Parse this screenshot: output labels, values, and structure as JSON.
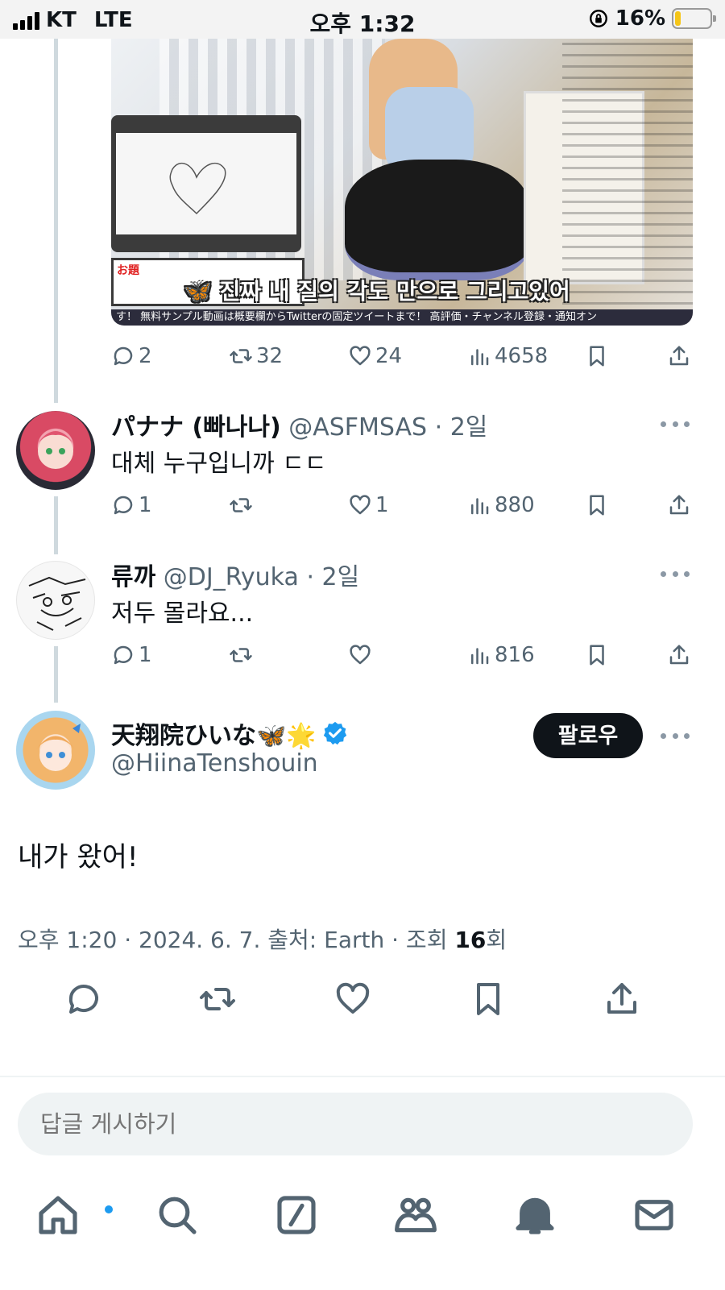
{
  "status_bar": {
    "carrier": "KT",
    "network": "LTE",
    "time": "오후 1:32",
    "battery_percent": "16%",
    "battery_level": 0.16
  },
  "media": {
    "board_label": "お題",
    "caption": "🦋 진짜 내 질의 각도 만으로 그리고있어",
    "ticker": "す！ 無料サンプル動画は概要欄からTwitterの固定ツイートまで！ 高評価・チャンネル登録・通知オン"
  },
  "quoted_post_actions": {
    "replies": "2",
    "reposts": "32",
    "likes": "24",
    "views": "4658"
  },
  "replies": [
    {
      "name": "パナナ (빠나나)",
      "handle": "@ASFMSAS",
      "time": "· 2일",
      "text": "대체 누구입니까 ㄷㄷ",
      "replies": "1",
      "reposts": "",
      "likes": "1",
      "views": "880"
    },
    {
      "name": "류까",
      "handle": "@DJ_Ryuka",
      "time": "· 2일",
      "text": "저두 몰라요...",
      "replies": "1",
      "reposts": "",
      "likes": "",
      "views": "816"
    }
  ],
  "main_post": {
    "name": "天翔院ひいな🦋🌟",
    "handle": "@HiinaTenshouin",
    "follow_label": "팔로우",
    "text": "내가 왔어!",
    "meta_prefix": "오후 1:20 · 2024. 6. 7. 출처: Earth · 조회 ",
    "views": "16",
    "views_suffix": "회"
  },
  "reply_input": {
    "placeholder": "답글 게시하기"
  },
  "bottom_nav": {
    "items": [
      "home-icon",
      "search-icon",
      "grok-icon",
      "communities-icon",
      "notifications-icon",
      "messages-icon"
    ],
    "has_home_notification": true
  },
  "colors": {
    "accent": "#1d9bf0",
    "text_primary": "#0f1419",
    "text_secondary": "#536471"
  }
}
